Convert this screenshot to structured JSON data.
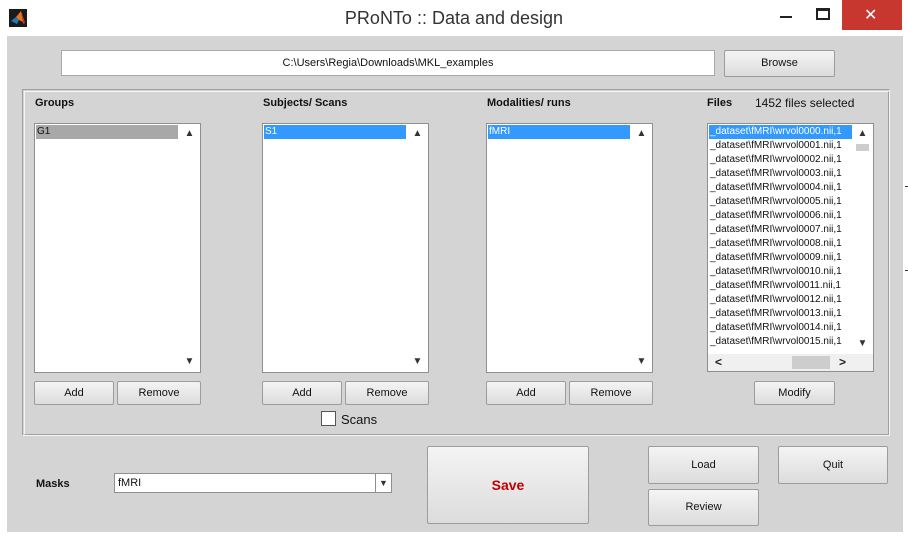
{
  "window": {
    "title": "PRoNTo :: Data and design",
    "minimize_glyph": "",
    "maximize_glyph": "",
    "close_glyph": "✕"
  },
  "path": {
    "value": "C:\\Users\\Regia\\Downloads\\MKL_examples"
  },
  "browse": {
    "label": "Browse"
  },
  "groups": {
    "label": "Groups",
    "items": [
      "G1"
    ],
    "add_label": "Add",
    "remove_label": "Remove"
  },
  "subjects": {
    "label": "Subjects/ Scans",
    "items": [
      "S1"
    ],
    "add_label": "Add",
    "remove_label": "Remove",
    "scans_label": "Scans",
    "scans_checked": false
  },
  "modalities": {
    "label": "Modalities/ runs",
    "items": [
      "fMRI"
    ],
    "add_label": "Add",
    "remove_label": "Remove"
  },
  "files": {
    "label": "Files",
    "count_text": "1452 files selected",
    "items": [
      "_dataset\\fMRI\\wrvol0000.nii,1",
      "_dataset\\fMRI\\wrvol0001.nii,1",
      "_dataset\\fMRI\\wrvol0002.nii,1",
      "_dataset\\fMRI\\wrvol0003.nii,1",
      "_dataset\\fMRI\\wrvol0004.nii,1",
      "_dataset\\fMRI\\wrvol0005.nii,1",
      "_dataset\\fMRI\\wrvol0006.nii,1",
      "_dataset\\fMRI\\wrvol0007.nii,1",
      "_dataset\\fMRI\\wrvol0008.nii,1",
      "_dataset\\fMRI\\wrvol0009.nii,1",
      "_dataset\\fMRI\\wrvol0010.nii,1",
      "_dataset\\fMRI\\wrvol0011.nii,1",
      "_dataset\\fMRI\\wrvol0012.nii,1",
      "_dataset\\fMRI\\wrvol0013.nii,1",
      "_dataset\\fMRI\\wrvol0014.nii,1",
      "_dataset\\fMRI\\wrvol0015.nii,1"
    ],
    "modify_label": "Modify"
  },
  "masks": {
    "label": "Masks",
    "selected": "fMRI"
  },
  "actions": {
    "save_label": "Save",
    "load_label": "Load",
    "quit_label": "Quit",
    "review_label": "Review"
  },
  "icons": {
    "app": "matlab-logo-icon",
    "arrow_up": "▲",
    "arrow_down": "▼",
    "arrow_left": "<",
    "arrow_right": ">"
  },
  "colors": {
    "selection_blue": "#3399ff",
    "selection_gray": "#a8a8a8",
    "save_text": "#c00000",
    "close_red": "#c7372f",
    "panel_gray": "#d4d4d4"
  }
}
